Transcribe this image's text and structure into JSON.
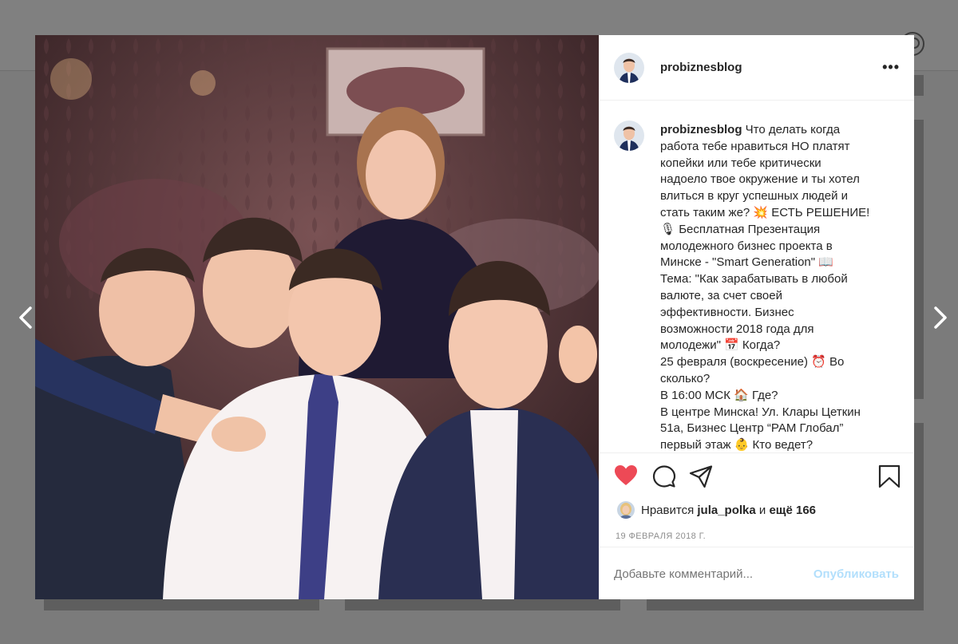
{
  "post": {
    "username": "probiznesblog",
    "caption_user": "probiznesblog",
    "caption_lines": [
      "Что делать когда",
      "работа тебе нравиться НО платят",
      "копейки или тебе критически",
      "надоело твое окружение и ты хотел",
      "влиться в круг успешных людей и",
      "стать таким же? 💥 ЕСТЬ РЕШЕНИЕ!",
      "🎙 Бесплатная Презентация",
      "молодежного бизнес проекта в",
      "Минске - \"Smart Generation\" 📖",
      "Тема: \"Как зарабатывать в любой",
      "валюте, за счет своей",
      "эффективности. Бизнес",
      "возможности 2018 года для",
      "молодежи\" 📅 Когда?",
      "25 февраля (воскресение) ⏰ Во",
      "сколько?",
      "В 16:00 МСК 🏠 Где?",
      "В центре Минска! Ул. Клары Цеткин",
      "51а, Бизнес Центр “РАМ Глобал”",
      "первый этаж 👶 Кто ведет?"
    ],
    "likes_prefix": "Нравится",
    "likes_user": "jula_polka",
    "likes_mid": "и",
    "likes_rest": "ещё 166",
    "date": "19 ФЕВРАЛЯ 2018 Г.",
    "comment_placeholder": "Добавьте комментарий...",
    "publish_label": "Опубликовать",
    "more_label": "•••",
    "icons": [
      "heart-icon",
      "comment-icon",
      "share-icon",
      "bookmark-icon"
    ],
    "colors": {
      "like": "#ed4956",
      "link": "#b2dffc",
      "text": "#262626",
      "muted": "#8e8e8e"
    }
  }
}
